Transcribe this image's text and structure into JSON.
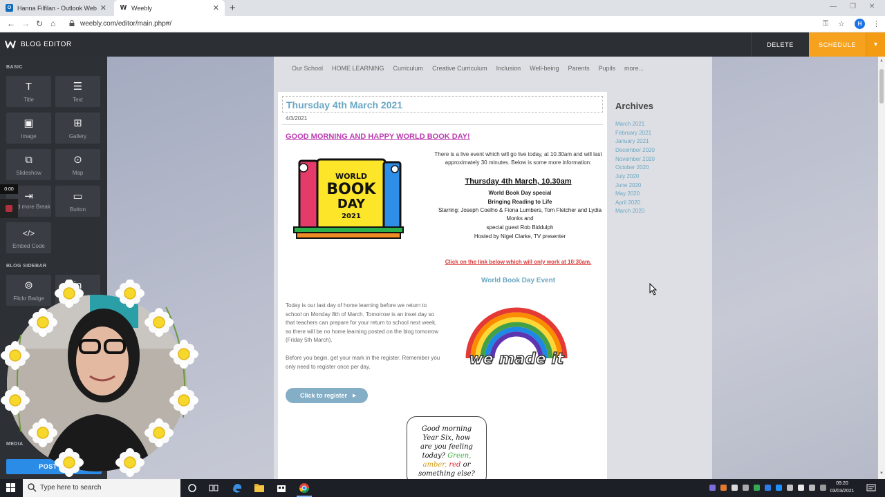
{
  "browser": {
    "tabs": [
      {
        "title": "Hanna Filfilan - Outlook Web Ap",
        "active": false
      },
      {
        "title": "Weebly",
        "active": true
      }
    ],
    "url": "weebly.com/editor/main.php#/",
    "profile_initial": "H"
  },
  "editor": {
    "title": "BLOG EDITOR",
    "delete_label": "DELETE",
    "schedule_label": "SCHEDULE"
  },
  "sidebar": {
    "sections": {
      "basic": "BASIC",
      "blog_sidebar": "BLOG SIDEBAR",
      "media": "MEDIA"
    },
    "tiles": [
      {
        "label": "Title",
        "icon": "title-icon"
      },
      {
        "label": "Text",
        "icon": "text-icon"
      },
      {
        "label": "Image",
        "icon": "image-icon"
      },
      {
        "label": "Gallery",
        "icon": "gallery-icon"
      },
      {
        "label": "Slideshow",
        "icon": "slideshow-icon"
      },
      {
        "label": "Map",
        "icon": "map-pin-icon"
      },
      {
        "label": "Read more Break",
        "icon": "read-more-icon"
      },
      {
        "label": "Button",
        "icon": "button-icon"
      },
      {
        "label": "Embed Code",
        "icon": "embed-code-icon"
      },
      {
        "label": "Flickr Badge",
        "icon": "flickr-icon"
      }
    ],
    "timer": "0:00",
    "post_label": "POST OP"
  },
  "site": {
    "nav": [
      "Our School",
      "HOME LEARNING",
      "Curriculum",
      "Creative Curriculum",
      "Inclusion",
      "Well-being",
      "Parents",
      "Pupils",
      "more..."
    ],
    "post": {
      "title": "Thursday 4th March 2021",
      "date": "4/3/2021",
      "greeting": "GOOD MORNING AND HAPPY WORLD BOOK DAY!",
      "live_paragraph": "There is a live event which will go live today, at 10.30am and will last approximately 30 minutes. Below is some more information:",
      "event_title": "Thursday 4th March, 10.30am",
      "event_subtitle": "World Book Day special",
      "event_tagline": "Bringing Reading to Life",
      "starring_line1": "Starring: Joseph Coelho & Fiona Lumbers, Tom Fletcher and Lydia",
      "starring_line2": "Monks and",
      "guest_line": "special guest Rob Biddulph",
      "host_line": "Hosted by Nigel Clarke, TV presenter",
      "link_note": "Click on the link below which will only work at 10:30am.",
      "event_link": "World Book Day Event",
      "today_paragraph": "Today is our last day of home learning before we return to school on Monday 8th of March. Tomorrow is an inset day so that teachers can prepare for your return to school next week, so there will be no home learning posted on the blog tomorrow (Friday 5th March).",
      "register_paragraph": "Before you begin, get your mark in the register. Remember you only need to register once per day.",
      "register_button": "Click to register",
      "book_logo": {
        "line1": "WORLD",
        "line2": "BOOK",
        "line3": "DAY",
        "year": "2021"
      },
      "rainbow_caption": "we made it",
      "speech": {
        "line1": "Good morning",
        "line2": "Year Six, how",
        "line3": "are you feeling",
        "line4_pre": "today?",
        "green": "Green,",
        "amber": "amber,",
        "red": "red",
        "or": "or",
        "line6": "something else?"
      }
    },
    "archives": {
      "heading": "Archives",
      "months": [
        "March 2021",
        "February 2021",
        "January 2021",
        "December 2020",
        "November 2020",
        "October 2020",
        "July 2020",
        "June 2020",
        "May 2020",
        "April 2020",
        "March 2020"
      ]
    }
  },
  "taskbar": {
    "search_placeholder": "Type here to search",
    "time": "09:20",
    "date": "03/03/2021"
  }
}
